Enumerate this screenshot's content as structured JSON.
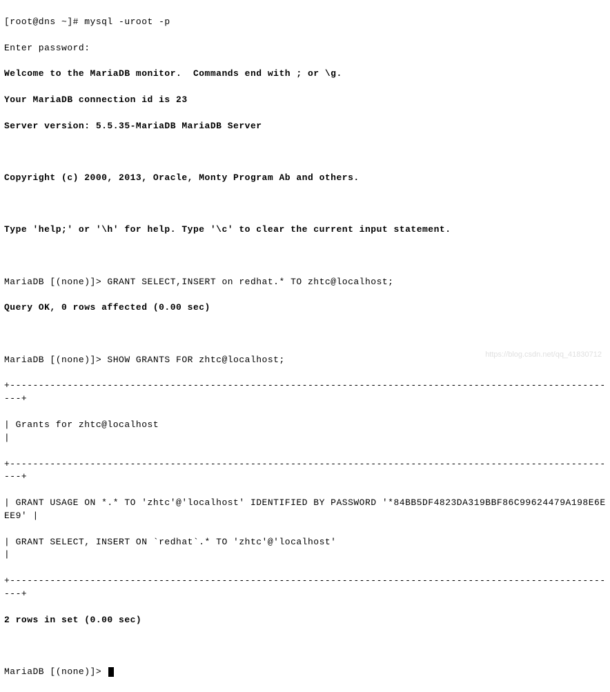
{
  "terminal": {
    "line1": "[root@dns ~]# mysql -uroot -p",
    "line2": "Enter password:",
    "line3": "Welcome to the MariaDB monitor.  Commands end with ; or \\g.",
    "line4": "Your MariaDB connection id is 23",
    "line5": "Server version: 5.5.35-MariaDB MariaDB Server",
    "blank1": "",
    "line6": "Copyright (c) 2000, 2013, Oracle, Monty Program Ab and others.",
    "blank2": "",
    "line7": "Type 'help;' or '\\h' for help. Type '\\c' to clear the current input statement.",
    "blank3": "",
    "line8": "MariaDB [(none)]> GRANT SELECT,INSERT on redhat.* TO zhtc@localhost;",
    "line9": "Query OK, 0 rows affected (0.00 sec)",
    "blank4": "",
    "line10": "MariaDB [(none)]> SHOW GRANTS FOR zhtc@localhost;",
    "line11": "+-----------------------------------------------------------------------------------------------------------+",
    "line12": "| Grants for zhtc@localhost                                                                                 |",
    "line13": "+-----------------------------------------------------------------------------------------------------------+",
    "line14": "| GRANT USAGE ON *.* TO 'zhtc'@'localhost' IDENTIFIED BY PASSWORD '*84BB5DF4823DA319BBF86C99624479A198E6EEE9' |",
    "line15": "| GRANT SELECT, INSERT ON `redhat`.* TO 'zhtc'@'localhost'                                                  |",
    "line16": "+-----------------------------------------------------------------------------------------------------------+",
    "line17": "2 rows in set (0.00 sec)",
    "blank5": "",
    "line18": "MariaDB [(none)]> "
  },
  "watermark": "https://blog.csdn.net/qq_41830712"
}
